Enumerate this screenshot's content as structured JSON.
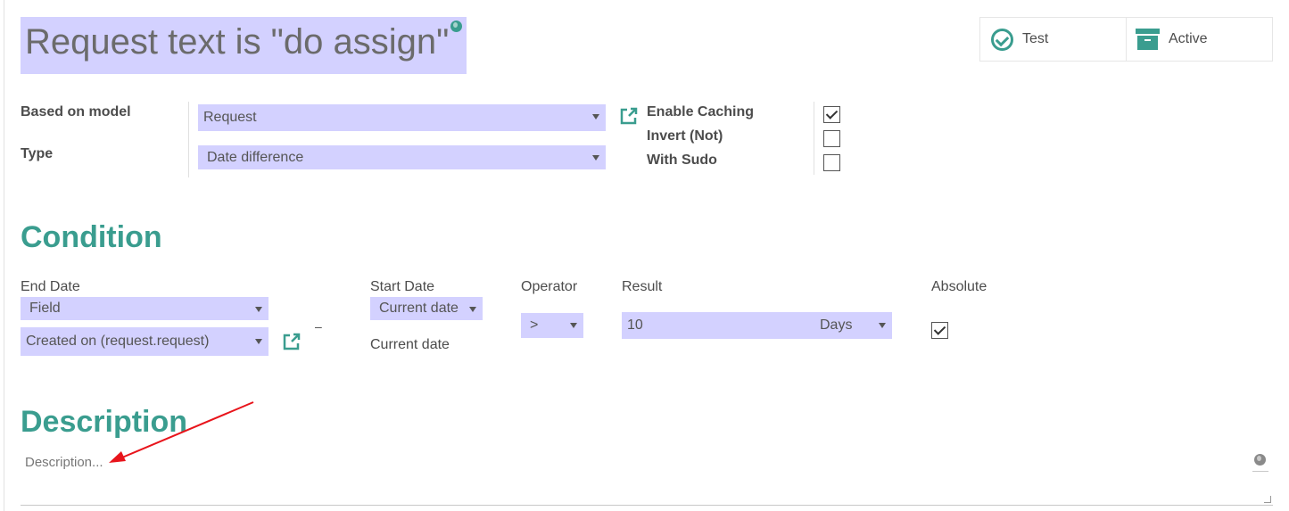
{
  "header": {
    "title": "Request text is \"do assign\""
  },
  "smart_buttons": [
    {
      "label": "Test",
      "icon": "check-circle-icon"
    },
    {
      "label": "Active",
      "icon": "archive-icon"
    }
  ],
  "form": {
    "based_on_model_label": "Based on model",
    "based_on_model_value": "Request",
    "type_label": "Type",
    "type_value": "Date difference",
    "enable_caching_label": "Enable Caching",
    "enable_caching": true,
    "invert_label": "Invert (Not)",
    "invert": false,
    "with_sudo_label": "With Sudo",
    "with_sudo": false
  },
  "condition": {
    "heading": "Condition",
    "end_date_label": "End Date",
    "end_date_type": "Field",
    "end_date_field": "Created on (request.request)",
    "separator": "–",
    "start_date_label": "Start Date",
    "start_date_type": "Current date",
    "start_date_value": "Current date",
    "operator_label": "Operator",
    "operator_value": ">",
    "result_label": "Result",
    "result_value": "10",
    "result_unit": "Days",
    "absolute_label": "Absolute",
    "absolute": true
  },
  "description": {
    "heading": "Description",
    "placeholder": "Description..."
  },
  "colors": {
    "accent": "#3a9d8f",
    "field_bg": "#d3d1ff",
    "annotation_arrow": "#e8141b"
  }
}
